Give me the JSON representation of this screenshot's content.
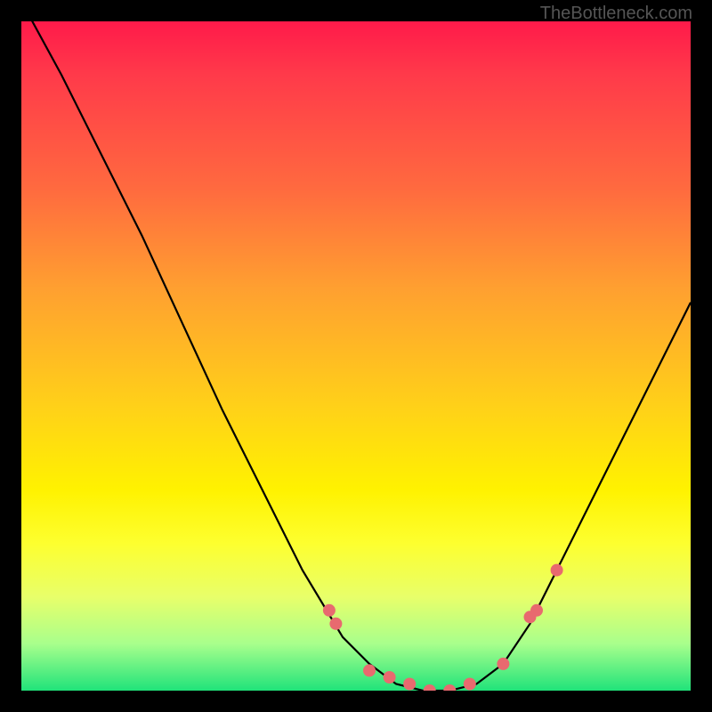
{
  "watermark": "TheBottleneck.com",
  "chart_data": {
    "type": "line",
    "title": "",
    "xlabel": "",
    "ylabel": "",
    "xlim": [
      0,
      100
    ],
    "ylim": [
      0,
      100
    ],
    "curve": {
      "x": [
        0,
        6,
        12,
        18,
        24,
        30,
        36,
        42,
        48,
        52,
        56,
        60,
        64,
        68,
        72,
        76,
        80,
        86,
        92,
        100
      ],
      "y": [
        103,
        92,
        80,
        68,
        55,
        42,
        30,
        18,
        8,
        4,
        1,
        0,
        0,
        1,
        4,
        10,
        18,
        30,
        42,
        58
      ]
    },
    "markers": {
      "x": [
        46,
        47,
        52,
        55,
        58,
        61,
        64,
        67,
        72,
        76,
        77,
        80
      ],
      "y": [
        12,
        10,
        3,
        2,
        1,
        0,
        0,
        1,
        4,
        11,
        12,
        18
      ]
    },
    "gradient_stops": [
      {
        "pos": 0,
        "color": "#ff1a4a"
      },
      {
        "pos": 25,
        "color": "#ff6a3f"
      },
      {
        "pos": 58,
        "color": "#ffd218"
      },
      {
        "pos": 78,
        "color": "#fdff2f"
      },
      {
        "pos": 100,
        "color": "#20e37a"
      }
    ]
  }
}
